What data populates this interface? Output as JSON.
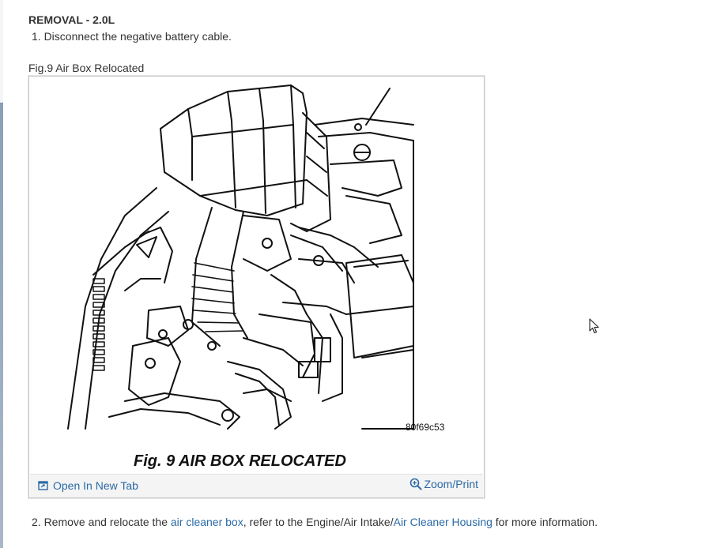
{
  "document": {
    "heading": "REMOVAL - 2.0L",
    "step1": "1. Disconnect the negative battery cable.",
    "figure_caption": "Fig.9 Air Box Relocated",
    "figure": {
      "part_code": "80f69c53",
      "title": "Fig. 9 AIR BOX RELOCATED",
      "open_label": "Open In New Tab",
      "zoom_label": "Zoom/Print"
    },
    "step2": {
      "prefix": "2. Remove and relocate the ",
      "link1": "air cleaner box",
      "middle": ", refer to the Engine/Air Intake/",
      "link2": "Air Cleaner Housing",
      "suffix": " for more information."
    }
  },
  "icons": {
    "open": "open-new-tab-icon",
    "zoom": "magnifier-icon",
    "cursor": "mouse-pointer-icon"
  },
  "colors": {
    "link": "#2a6aa6",
    "text": "#333333"
  }
}
